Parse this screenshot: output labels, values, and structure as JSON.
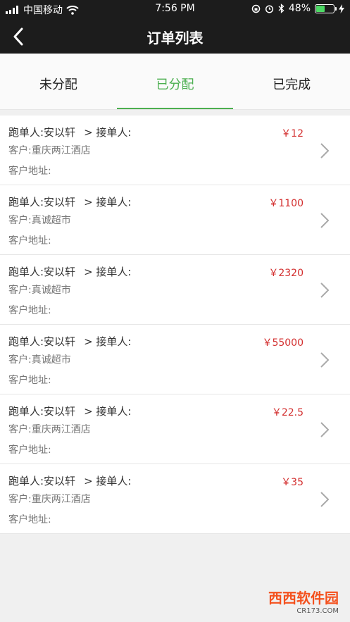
{
  "status_bar": {
    "carrier": "中国移动",
    "time": "7:56 PM",
    "battery": "48%",
    "battery_level": 0.48
  },
  "nav": {
    "title": "订单列表"
  },
  "tabs": [
    {
      "label": "未分配"
    },
    {
      "label": "已分配"
    },
    {
      "label": "已完成"
    }
  ],
  "orders": [
    {
      "runner": "跑单人:安以轩",
      "receiver": "> 接单人:",
      "customer": "客户:重庆两江酒店",
      "address": "客户地址:",
      "price": "￥12"
    },
    {
      "runner": "跑单人:安以轩",
      "receiver": "> 接单人:",
      "customer": "客户:真诚超市",
      "address": "客户地址:",
      "price": "￥1100"
    },
    {
      "runner": "跑单人:安以轩",
      "receiver": "> 接单人:",
      "customer": "客户:真诚超市",
      "address": "客户地址:",
      "price": "￥2320"
    },
    {
      "runner": "跑单人:安以轩",
      "receiver": "> 接单人:",
      "customer": "客户:真诚超市",
      "address": "客户地址:",
      "price": "￥55000"
    },
    {
      "runner": "跑单人:安以轩",
      "receiver": "> 接单人:",
      "customer": "客户:重庆两江酒店",
      "address": "客户地址:",
      "price": "￥22.5"
    },
    {
      "runner": "跑单人:安以轩",
      "receiver": "> 接单人:",
      "customer": "客户:重庆两江酒店",
      "address": "客户地址:",
      "price": "￥35"
    }
  ],
  "watermark": {
    "main": "西西软件园",
    "sub": "CR173.COM"
  }
}
